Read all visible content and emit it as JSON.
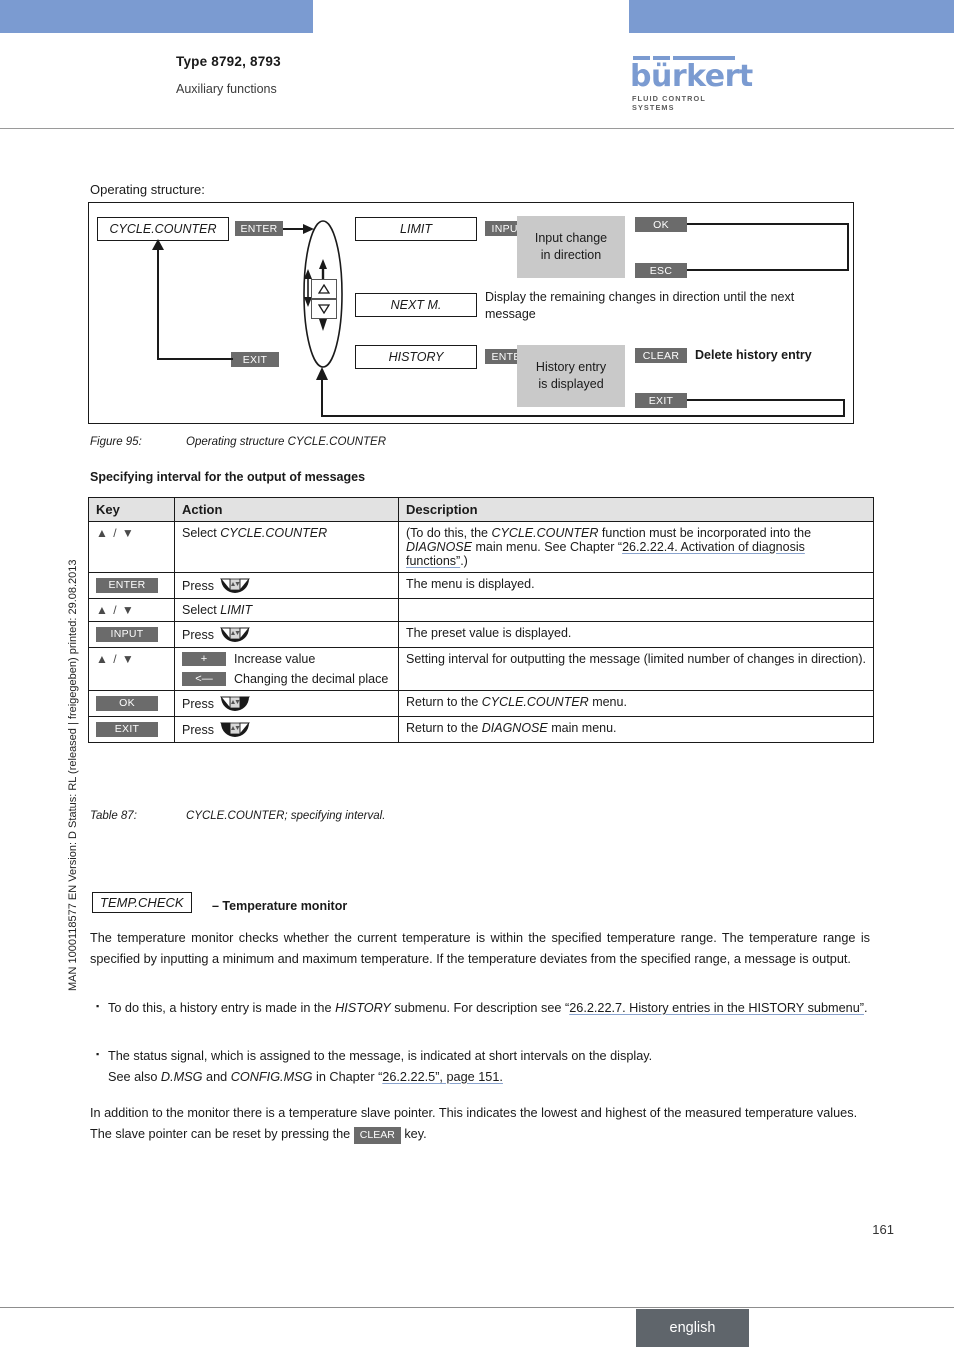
{
  "header": {
    "type_line": "Type 8792, 8793",
    "subtitle": "Auxiliary functions",
    "logo_word": "bürkert",
    "logo_tagline": "FLUID CONTROL SYSTEMS"
  },
  "side_stamp": "MAN 1000118577  EN  Version: D  Status: RL (released | freigegeben)  printed: 29.08.2013",
  "intro": {
    "operating_structure_label": "Operating structure:"
  },
  "diagram": {
    "nodes": {
      "root": "CYCLE.COUNTER",
      "limit": "LIMIT",
      "next_m": "NEXT M.",
      "history": "HISTORY"
    },
    "keys": {
      "enter_root": "ENTER",
      "exit_root": "EXIT",
      "input_limit": "INPUT",
      "enter_history": "ENTER",
      "ok": "OK",
      "esc": "ESC",
      "clear": "CLEAR",
      "exit_history": "EXIT"
    },
    "panels": {
      "input_change": "Input change\nin direction",
      "input_change_l1": "Input change",
      "input_change_l2": "in direction",
      "history_entry_l1": "History entry",
      "history_entry_l2": "is displayed"
    },
    "texts": {
      "next_m_desc_l1": "Display the remaining changes in direction until the next",
      "next_m_desc_l2": "message",
      "delete_history": "Delete history entry"
    },
    "arrow_up_icon": "triangle-up",
    "arrow_down_icon": "triangle-down"
  },
  "figure_caption": {
    "label": "Figure 95:",
    "text": "Operating structure CYCLE.COUNTER"
  },
  "section_heading": "Specifying interval for the output of messages",
  "table": {
    "columns": [
      "Key",
      "Action",
      "Description"
    ],
    "rows": [
      {
        "key_type": "arrows",
        "key": "▲ / ▼",
        "action_text": "Select ",
        "action_italic": "CYCLE.COUNTER",
        "desc_parts": {
          "p1": "(To do this, the ",
          "i1": "CYCLE.COUNTER",
          "p2": " function must be incorporated into the ",
          "i2": "DIAGNOSE",
          "p3": " main menu. See Chapter “",
          "link": "26.2.22.4. Activation of diagnosis functions”",
          "p4": ".)"
        }
      },
      {
        "key_type": "badge",
        "key": "ENTER",
        "action_text": "Press",
        "press_icon": "press-key-center",
        "desc": "The menu is displayed."
      },
      {
        "key_type": "arrows",
        "key": "▲ / ▼",
        "action_text": "Select ",
        "action_italic": "LIMIT",
        "desc": ""
      },
      {
        "key_type": "badge",
        "key": "INPUT",
        "action_text": "Press",
        "press_icon": "press-key-center",
        "desc": "The preset value is displayed."
      },
      {
        "key_type": "arrows",
        "key": "▲ / ▼",
        "action_lines": [
          {
            "badge": "+",
            "text": "Increase value"
          },
          {
            "badge": "<—",
            "text": "Changing the decimal place"
          }
        ],
        "desc": "Setting interval for outputting the message (limited number of changes in direction)."
      },
      {
        "key_type": "badge",
        "key": "OK",
        "action_text": "Press",
        "press_icon": "press-key-right",
        "desc_text": "Return to the ",
        "desc_italic": "CYCLE.COUNTER",
        "desc_tail": " menu."
      },
      {
        "key_type": "badge",
        "key": "EXIT",
        "action_text": "Press",
        "press_icon": "press-key-left",
        "desc_text": "Return to the ",
        "desc_italic": "DIAGNOSE",
        "desc_tail": " main menu."
      }
    ]
  },
  "table_caption": {
    "label": "Table 87:",
    "text": "CYCLE.COUNTER; specifying interval."
  },
  "temp_section": {
    "box_label": "TEMP.CHECK",
    "title": "– Temperature monitor",
    "paragraph": "The temperature monitor checks whether the current temperature is within the specified temperature range. The temperature range is specified by inputting a minimum and maximum temperature. If the temperature deviates from the specified range, a message is output.",
    "bullets": [
      {
        "p1": "To do this, a history entry is made in the ",
        "i1": "HISTORY",
        "p2": " submenu. For description see “",
        "link": "26.2.22.7. History entries in the HISTORY submenu”",
        "p3": "."
      },
      {
        "p1": "The status signal, which is assigned to the message, is indicated at short intervals on the display.",
        "p2": "See also ",
        "i1": "D.MSG",
        "p3": " and ",
        "i2": "CONFIG.MSG",
        "p4": " in Chapter “",
        "link": "26.2.22.5”, page 151.",
        "p5": ""
      }
    ],
    "closing_p1": "In addition to the monitor there is a temperature slave pointer. This indicates the lowest and highest of the measured temperature values. The slave pointer can be reset by pressing the ",
    "closing_badge": "CLEAR",
    "closing_p2": " key."
  },
  "footer": {
    "page_number": "161",
    "language_tab": "english"
  },
  "colors": {
    "brand_blue": "#7b9bd1",
    "key_badge_gray": "#6b6b6b",
    "panel_gray": "#c9c9c9",
    "table_header_gray": "#e2e2e2",
    "footer_tab_gray": "#5f656b",
    "link_underline": "#8aa4cf"
  }
}
